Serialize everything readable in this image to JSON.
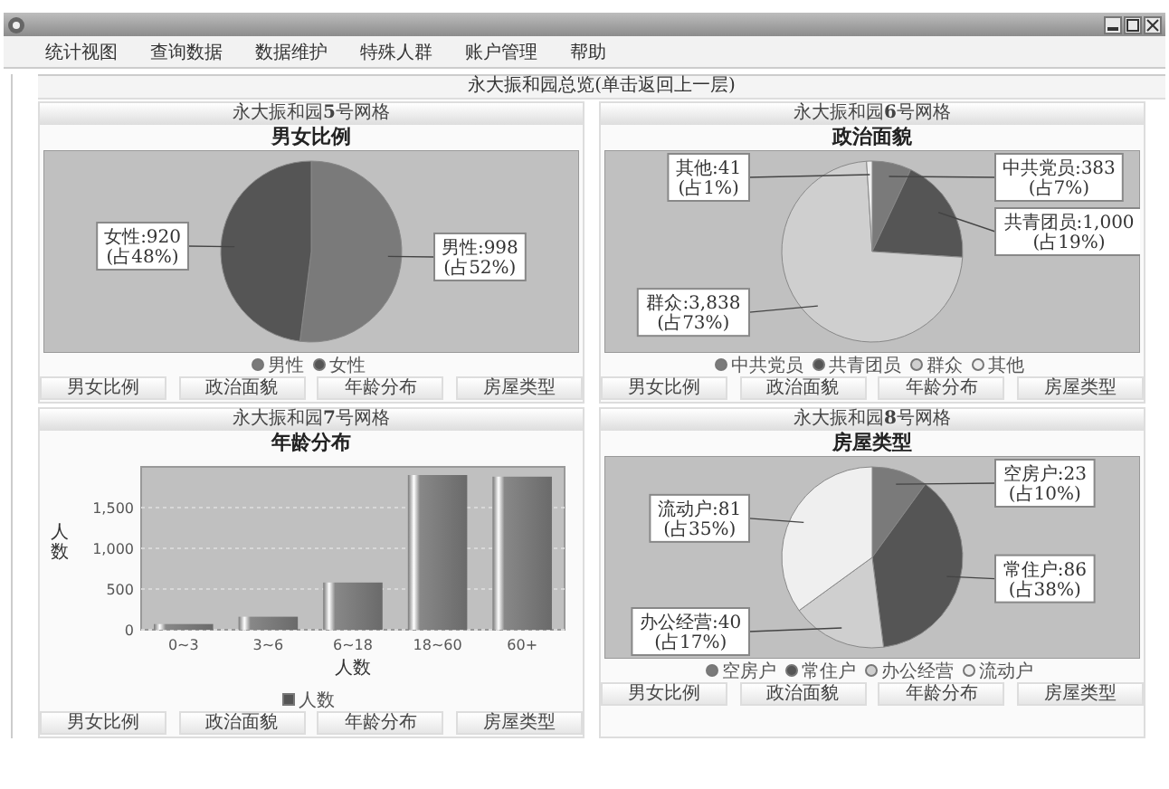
{
  "menu": [
    {
      "label": "统计视图"
    },
    {
      "label": "查询数据"
    },
    {
      "label": "数据维护"
    },
    {
      "label": "特殊人群"
    },
    {
      "label": "账户管理"
    },
    {
      "label": "帮助"
    }
  ],
  "overview_title": "永大振和园总览(单击返回上一层)",
  "panels": [
    {
      "header": "永大振和园**5**号网格",
      "chart_data": {
        "type": "pie",
        "title": "男女比例",
        "categories": [
          "男性",
          "女性"
        ],
        "values": [
          52,
          48
        ],
        "value_labels": [
          [
            "男性:998",
            "(占52%)"
          ],
          [
            "女性:920",
            "(占48%)"
          ]
        ]
      },
      "buttons": [
        "男女比例",
        "政治面貌",
        "年龄分布",
        "房屋类型"
      ]
    },
    {
      "header": "永大振和园**6**号网格",
      "chart_data": {
        "type": "pie",
        "title": "政治面貌",
        "categories": [
          "中共党员",
          "共青团员",
          "群众",
          "其他"
        ],
        "values": [
          7,
          19,
          73,
          1
        ],
        "value_labels": [
          [
            "中共党员:383",
            "(占7%)"
          ],
          [
            "共青团员:1,000",
            "(占19%)"
          ],
          [
            "群众:3,838",
            "(占73%)"
          ],
          [
            "其他:41",
            "(占1%)"
          ]
        ]
      },
      "buttons": [
        "男女比例",
        "政治面貌",
        "年龄分布",
        "房屋类型"
      ]
    },
    {
      "header": "永大振和园**7**号网格",
      "chart_data": {
        "type": "bar",
        "title": "年龄分布",
        "xlabel": "人数",
        "ylabel": "人数",
        "categories": [
          "0~3",
          "3~6",
          "6~18",
          "18~60",
          "60+"
        ],
        "series": [
          {
            "name": "人数",
            "values": [
              70,
              160,
              580,
              1900,
              1880
            ]
          }
        ],
        "ylim": [
          0,
          2000
        ],
        "grid": true,
        "yticks": [
          {
            "value": 0,
            "label": "0"
          },
          {
            "value": 500,
            "label": "500"
          },
          {
            "value": 1000,
            "label": "1,000"
          },
          {
            "value": 1500,
            "label": "1,500"
          }
        ]
      },
      "buttons": [
        "男女比例",
        "政治面貌",
        "年龄分布",
        "房屋类型"
      ]
    },
    {
      "header": "永大振和园**8**号网格",
      "chart_data": {
        "type": "pie",
        "title": "房屋类型",
        "categories": [
          "空房户",
          "常住户",
          "办公经营",
          "流动户"
        ],
        "values": [
          10,
          38,
          17,
          35
        ],
        "value_labels": [
          [
            "空房户:23",
            "(占10%)"
          ],
          [
            "常住户:86",
            "(占38%)"
          ],
          [
            "办公经营:40",
            "(占17%)"
          ],
          [
            "流动户:81",
            "(占35%)"
          ]
        ]
      },
      "buttons": [
        "男女比例",
        "政治面貌",
        "年龄分布",
        "房屋类型"
      ]
    }
  ]
}
